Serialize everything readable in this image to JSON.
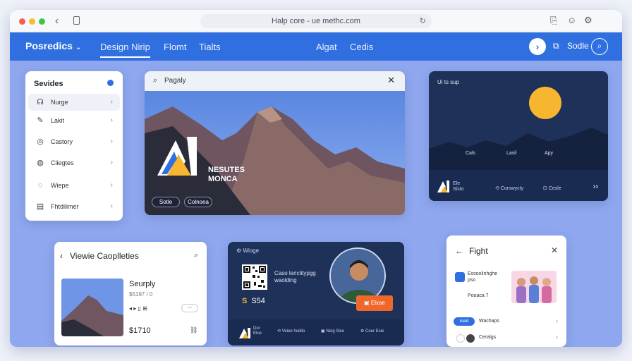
{
  "browser": {
    "url": "Halp core - ue methc.com"
  },
  "navbar": {
    "brand": "Posredics",
    "links": [
      "Design Nirip",
      "Flomt",
      "Tialts",
      "Algat",
      "Cedis"
    ],
    "tool_label": "Sodle"
  },
  "services": {
    "title": "Sevides",
    "items": [
      {
        "label": "Nurge",
        "icon": "headset-icon"
      },
      {
        "label": "Lakit",
        "icon": "pen-icon"
      },
      {
        "label": "Castory",
        "icon": "compass-icon"
      },
      {
        "label": "Cliegtes",
        "icon": "globe-icon"
      },
      {
        "label": "Wiepe",
        "icon": "chat-icon"
      },
      {
        "label": "Fhtdilimer",
        "icon": "calendar-icon"
      }
    ]
  },
  "hero": {
    "search_text": "Pagaly",
    "logo_line1": "NESUTES",
    "logo_line2": "MONCA",
    "pill1": "Sotle",
    "pill2": "Colnoea"
  },
  "scape": {
    "title": "Ui ts sup",
    "labels": [
      "Cals",
      "Lasil",
      "Apy"
    ],
    "bottom_items": [
      "Ele Sisto",
      "Corswycty",
      "Cesle"
    ]
  },
  "views": {
    "title": "Viewie Caoplleties",
    "item_name": "Seurply",
    "item_sub": "$5197 / 0",
    "controls": "◂  ▸  ▯  ⊞",
    "chip": "◦◦◦",
    "price": "$1710"
  },
  "ticket": {
    "top_label": "Wioge",
    "qr_text_1": "Caso lericlitypgg",
    "qr_text_2": "waolding",
    "price_s": "S",
    "price": "S54",
    "cta": "Elxae",
    "foot_items": [
      "Dur Elue",
      "Veiee hodilo",
      "Neig Sise",
      "Cour Esie"
    ]
  },
  "fight": {
    "title": "Fight",
    "t1a": "Essoolinhghe",
    "t1b": "pso",
    "t2": "Pooaca 7",
    "badge": "Iceld",
    "row1": "Wachaps",
    "row2": "Ceralgs"
  },
  "colors": {
    "accent": "#2f6fe0",
    "dark": "#1e3159",
    "sun": "#f6b62f",
    "cta": "#f0672b"
  }
}
